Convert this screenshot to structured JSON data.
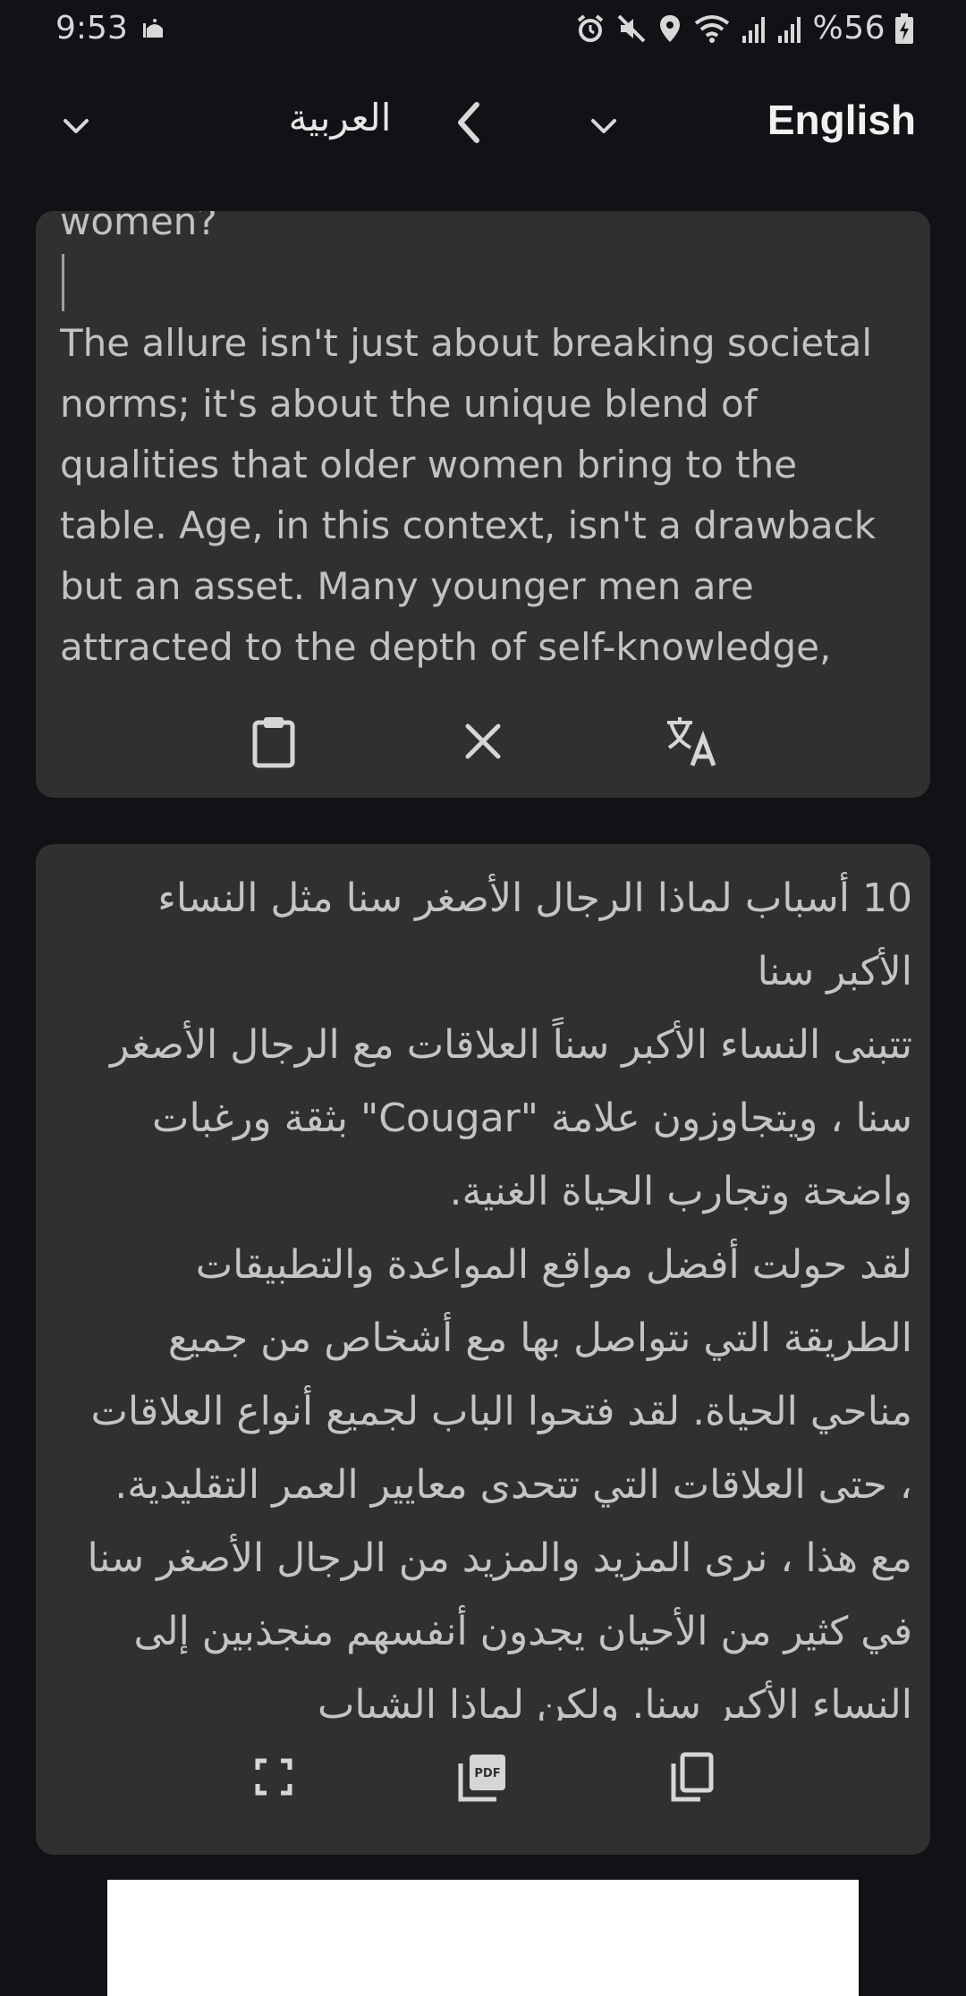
{
  "status_bar": {
    "time": "9:53",
    "battery": "%56",
    "icons": [
      "mosque-icon",
      "alarm-icon",
      "mute-icon",
      "location-icon",
      "wifi-icon",
      "signal-icon",
      "signal-icon",
      "battery-charging-icon"
    ]
  },
  "header": {
    "target_language": "العربية",
    "source_language": "English",
    "icons": [
      "chevron-down-icon",
      "chevron-left-icon",
      "chevron-down-icon"
    ]
  },
  "source_card": {
    "text_start": "women?",
    "text": "The allure isn't just about breaking societal norms; it's about the unique blend of qualities that older women bring to the table. Age, in this context, isn't a drawback but an asset. Many younger men are attracted to the depth of self-knowledge,",
    "actions": [
      "clipboard-icon",
      "clear-icon",
      "translate-icon"
    ]
  },
  "target_card": {
    "text": "10 أسباب لماذا الرجال الأصغر سنا مثل النساء الأكبر سنا\nتتبنى النساء الأكبر سناً العلاقات مع الرجال الأصغر سنا ، ويتجاوزون علامة \"Cougar\" بثقة ورغبات واضحة وتجارب الحياة الغنية.\nلقد حولت أفضل مواقع المواعدة والتطبيقات الطريقة التي نتواصل بها مع أشخاص من جميع مناحي الحياة. لقد فتحوا الباب لجميع أنواع العلاقات ، حتى العلاقات التي تتحدى معايير العمر التقليدية. مع هذا ، نرى المزيد والمزيد من الرجال الأصغر سنا في كثير من الأحيان يجدون أنفسهم منجذبين إلى النساء الأكبر سنا. ولكن لماذا الشباب",
    "actions": [
      "fullscreen-icon",
      "pdf-icon",
      "copy-icon"
    ]
  },
  "colors": {
    "background": "#111116",
    "card": "#303030",
    "text": "#c4c4c4"
  }
}
